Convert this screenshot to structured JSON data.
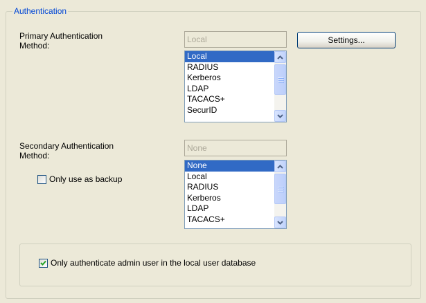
{
  "group": {
    "title": "Authentication"
  },
  "primary": {
    "label_line1": "Primary Authentication",
    "label_line2": "Method:",
    "current_value": "Local",
    "settings_label": "Settings...",
    "options": [
      "Local",
      "RADIUS",
      "Kerberos",
      "LDAP",
      "TACACS+",
      "SecurID"
    ],
    "selected_index": 0
  },
  "secondary": {
    "label_line1": "Secondary Authentication",
    "label_line2": "Method:",
    "current_value": "None",
    "backup_label": "Only use as backup",
    "backup_checked": false,
    "options": [
      "None",
      "Local",
      "RADIUS",
      "Kerberos",
      "LDAP",
      "TACACS+"
    ],
    "selected_index": 0
  },
  "local_only": {
    "label": "Only authenticate admin user in the local user database",
    "checked": true
  },
  "colors": {
    "title": "#0046d5",
    "selection": "#316ac5",
    "background": "#ece9d8"
  }
}
